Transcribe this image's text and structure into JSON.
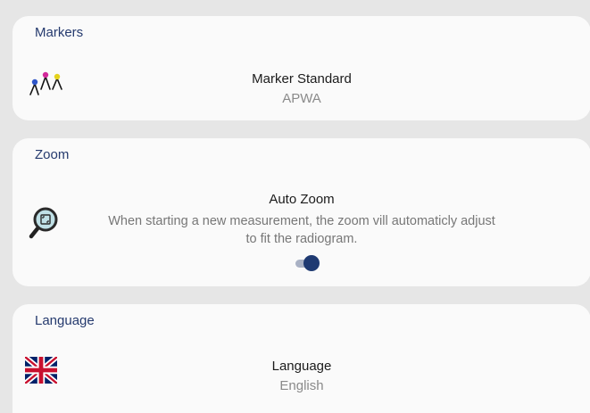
{
  "markers": {
    "section_title": "Markers",
    "icon": "marker-figures-icon",
    "title": "Marker Standard",
    "value": "APWA"
  },
  "zoom": {
    "section_title": "Zoom",
    "icon": "magnifier-fit-icon",
    "title": "Auto Zoom",
    "description_line1": "When starting a new measurement, the zoom vill automaticly adjust",
    "description_line2": "to fit the radiogram.",
    "toggle_on": true
  },
  "language": {
    "section_title": "Language",
    "icon": "uk-flag-icon",
    "title": "Language",
    "value": "English"
  },
  "colors": {
    "accent": "#1f3a72",
    "section_title": "#253a6e",
    "card": "#fafafa",
    "background": "#e6e6e6"
  }
}
